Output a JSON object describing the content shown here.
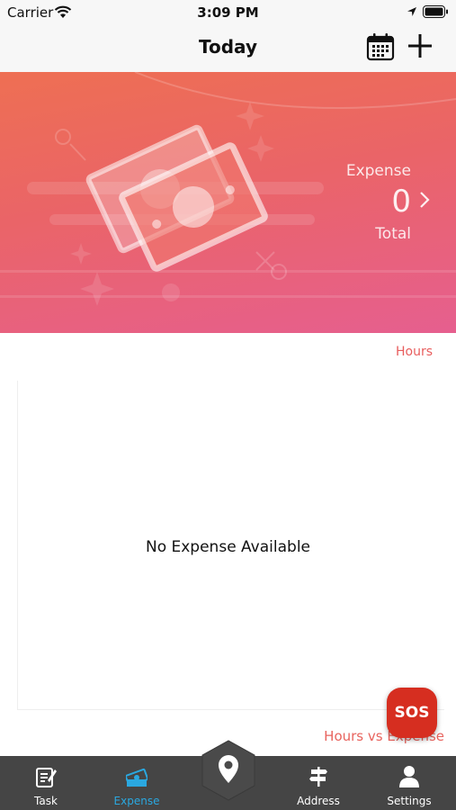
{
  "status_bar": {
    "carrier": "Carrier",
    "time": "3:09 PM"
  },
  "nav": {
    "title": "Today"
  },
  "banner": {
    "label": "Expense",
    "total_value": "0",
    "total_label": "Total"
  },
  "content": {
    "hours_link": "Hours",
    "empty_message": "No Expense Available",
    "chart_caption": "Hours vs Expense",
    "sos_label": "SOS"
  },
  "tabs": [
    {
      "label": "Task",
      "icon": "task-icon",
      "active": false
    },
    {
      "label": "Expense",
      "icon": "expense-icon",
      "active": true
    },
    {
      "label": "",
      "icon": "location-pin-icon",
      "active": false
    },
    {
      "label": "Address",
      "icon": "signpost-icon",
      "active": false
    },
    {
      "label": "Settings",
      "icon": "person-icon",
      "active": false
    }
  ],
  "colors": {
    "banner_start": "#ee6f53",
    "banner_end": "#e65f8f",
    "accent": "#e85d5d",
    "active_tab": "#2aa8e0",
    "tab_bar": "#454545",
    "sos": "#d62e20"
  }
}
